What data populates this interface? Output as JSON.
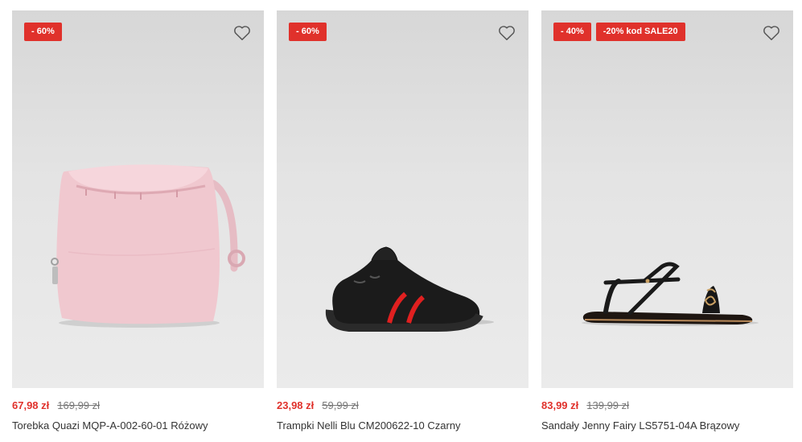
{
  "products": [
    {
      "badges": [
        "- 60%"
      ],
      "price_new": "67,98 zł",
      "price_old": "169,99 zł",
      "name": "Torebka Quazi MQP-A-002-60-01 Różowy",
      "image_icon": "bucket-bag-pink"
    },
    {
      "badges": [
        "- 60%"
      ],
      "price_new": "23,98 zł",
      "price_old": "59,99 zł",
      "name": "Trampki Nelli Blu CM200622-10 Czarny",
      "image_icon": "kids-sneaker-black"
    },
    {
      "badges": [
        "- 40%",
        "-20% kod SALE20"
      ],
      "price_new": "83,99 zł",
      "price_old": "139,99 zł",
      "name": "Sandały Jenny Fairy LS5751-04A Brązowy",
      "image_icon": "flat-sandal-black"
    }
  ],
  "colors": {
    "accent": "#e0312b",
    "old_price": "#777777",
    "image_bg": "#e3e3e3"
  },
  "favorite_icon": "heart-icon"
}
